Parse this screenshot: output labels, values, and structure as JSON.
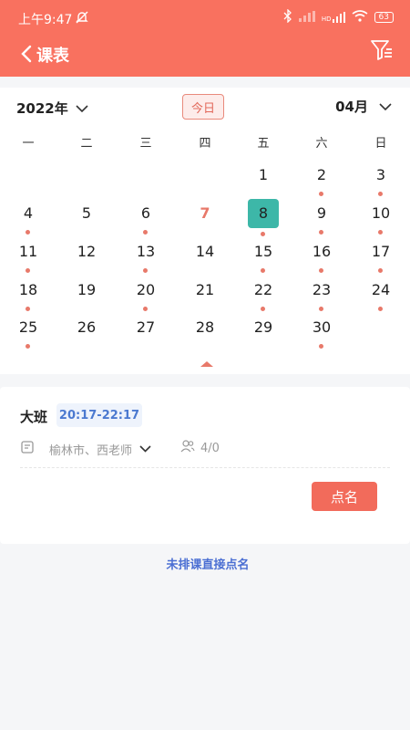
{
  "status_bar": {
    "time": "上午9:47",
    "network": "HD",
    "battery": "63"
  },
  "nav": {
    "title": "课表"
  },
  "calendar": {
    "year": "2022年",
    "today_label": "今日",
    "month": "04月",
    "weekdays": [
      "一",
      "二",
      "三",
      "四",
      "五",
      "六",
      "日"
    ],
    "days": [
      {
        "n": "1",
        "col": 4,
        "row": 0
      },
      {
        "n": "2",
        "col": 5,
        "row": 0,
        "dot": true
      },
      {
        "n": "3",
        "col": 6,
        "row": 0,
        "dot": true
      },
      {
        "n": "4",
        "col": 0,
        "row": 1,
        "dot": true
      },
      {
        "n": "5",
        "col": 1,
        "row": 1
      },
      {
        "n": "6",
        "col": 2,
        "row": 1,
        "dot": true
      },
      {
        "n": "7",
        "col": 3,
        "row": 1,
        "today": true
      },
      {
        "n": "8",
        "col": 4,
        "row": 1,
        "dot": true,
        "selected": true
      },
      {
        "n": "9",
        "col": 5,
        "row": 1,
        "dot": true
      },
      {
        "n": "10",
        "col": 6,
        "row": 1,
        "dot": true
      },
      {
        "n": "11",
        "col": 0,
        "row": 2,
        "dot": true
      },
      {
        "n": "12",
        "col": 1,
        "row": 2
      },
      {
        "n": "13",
        "col": 2,
        "row": 2,
        "dot": true
      },
      {
        "n": "14",
        "col": 3,
        "row": 2
      },
      {
        "n": "15",
        "col": 4,
        "row": 2,
        "dot": true
      },
      {
        "n": "16",
        "col": 5,
        "row": 2,
        "dot": true
      },
      {
        "n": "17",
        "col": 6,
        "row": 2,
        "dot": true
      },
      {
        "n": "18",
        "col": 0,
        "row": 3,
        "dot": true
      },
      {
        "n": "19",
        "col": 1,
        "row": 3
      },
      {
        "n": "20",
        "col": 2,
        "row": 3,
        "dot": true
      },
      {
        "n": "21",
        "col": 3,
        "row": 3
      },
      {
        "n": "22",
        "col": 4,
        "row": 3,
        "dot": true
      },
      {
        "n": "23",
        "col": 5,
        "row": 3,
        "dot": true
      },
      {
        "n": "24",
        "col": 6,
        "row": 3,
        "dot": true
      },
      {
        "n": "25",
        "col": 0,
        "row": 4,
        "dot": true
      },
      {
        "n": "26",
        "col": 1,
        "row": 4
      },
      {
        "n": "27",
        "col": 2,
        "row": 4
      },
      {
        "n": "28",
        "col": 3,
        "row": 4
      },
      {
        "n": "29",
        "col": 4,
        "row": 4
      },
      {
        "n": "30",
        "col": 5,
        "row": 4,
        "dot": true
      }
    ]
  },
  "lesson": {
    "class_name": "大班",
    "time": "20:17-22:17",
    "location": "榆林市、西老师",
    "attendance": "4/0",
    "call_button": "点名"
  },
  "footer": {
    "direct_call_link": "未排课直接点名"
  },
  "colors": {
    "brand": "#f9715f",
    "accent_dot": "#e8796a",
    "selected": "#3db7a8",
    "link": "#4b6fd3"
  },
  "icons": [
    "bell-off-icon",
    "bluetooth-icon",
    "signal-icon",
    "wifi-icon",
    "battery-icon",
    "back-chevron-icon",
    "filter-icon",
    "chevron-down-icon",
    "location-icon",
    "people-icon",
    "collapse-arrow-icon"
  ]
}
